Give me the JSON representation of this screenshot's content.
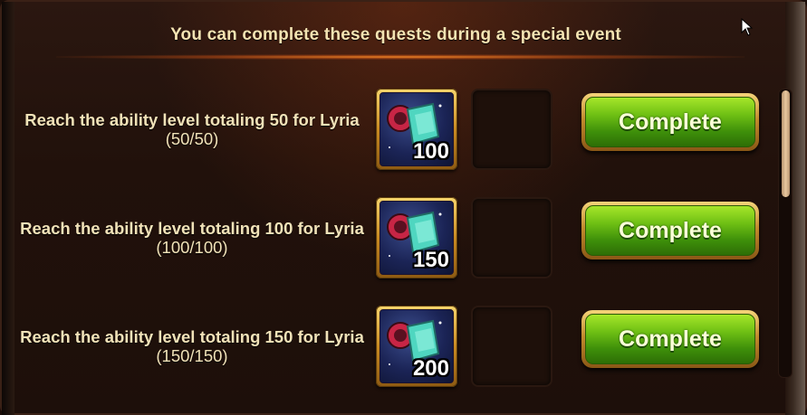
{
  "header": {
    "title": "You can complete these quests during a special event"
  },
  "quests": [
    {
      "title": "Reach the ability level totaling 50 for Lyria",
      "progress": "(50/50)",
      "reward_count": "100",
      "button_label": "Complete"
    },
    {
      "title": "Reach the ability level totaling 100 for Lyria",
      "progress": "(100/100)",
      "reward_count": "150",
      "button_label": "Complete"
    },
    {
      "title": "Reach the ability level totaling 150 for Lyria",
      "progress": "(150/150)",
      "reward_count": "200",
      "button_label": "Complete"
    }
  ],
  "icons": {
    "reward": "skill-card-icon",
    "cursor": "mouse-pointer-icon"
  },
  "colors": {
    "button_green": "#6fc014",
    "gold_frame": "#c88a22",
    "header_text": "#f4e3b2"
  }
}
